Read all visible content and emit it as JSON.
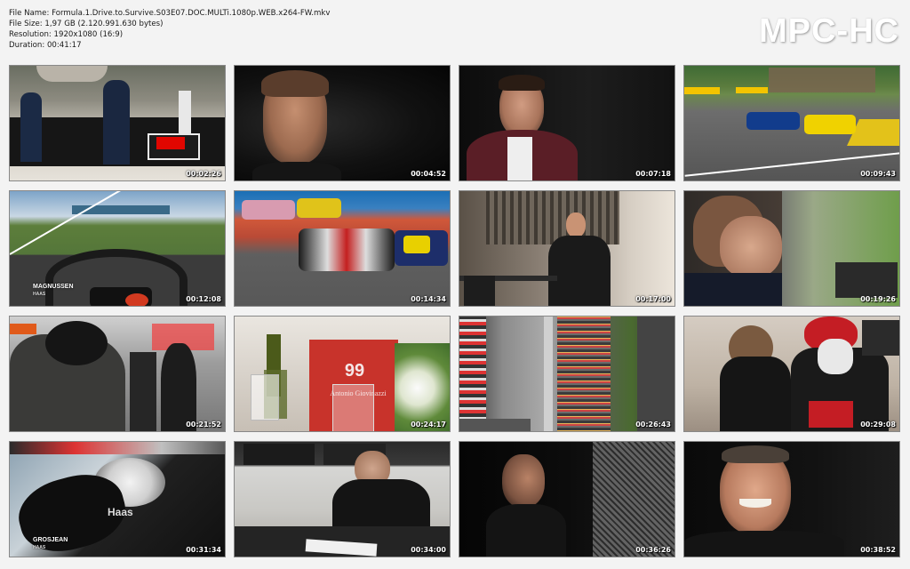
{
  "file_info": {
    "name": "File Name: Formula.1.Drive.to.Survive.S03E07.DOC.MULTi.1080p.WEB.x264-FW.mkv",
    "size": "File Size: 1,97 GB (2.120.991.630 bytes)",
    "resolution": "Resolution: 1920x1080 (16:9)",
    "duration": "Duration: 00:41:17"
  },
  "logo": "MPC-HC",
  "thumbnails": [
    {
      "time": "00:02:26",
      "scene": "paddock"
    },
    {
      "time": "00:04:52",
      "scene": "interview-driver"
    },
    {
      "time": "00:07:18",
      "scene": "interview-man"
    },
    {
      "time": "00:09:43",
      "scene": "race-track"
    },
    {
      "time": "00:12:08",
      "scene": "onboard-magnussen",
      "caption": "MAGNUSSEN",
      "caption2": "HAAS"
    },
    {
      "time": "00:14:34",
      "scene": "haas-car"
    },
    {
      "time": "00:17:00",
      "scene": "steiner-phone"
    },
    {
      "time": "00:19:26",
      "scene": "man-window"
    },
    {
      "time": "00:21:52",
      "scene": "pit-crew"
    },
    {
      "time": "00:24:17",
      "scene": "giovinazzi-table",
      "sign_number": "99",
      "sign_name": "Antonio Giovinazzi"
    },
    {
      "time": "00:26:43",
      "scene": "grid-aerial"
    },
    {
      "time": "00:29:08",
      "scene": "haas-mechanics"
    },
    {
      "time": "00:31:34",
      "scene": "onboard-grosjean",
      "caption": "GROSJEAN",
      "caption2": "HAAS"
    },
    {
      "time": "00:34:00",
      "scene": "engineer-desk"
    },
    {
      "time": "00:36:26",
      "scene": "grosjean-profile"
    },
    {
      "time": "00:38:52",
      "scene": "steiner-laugh"
    }
  ]
}
